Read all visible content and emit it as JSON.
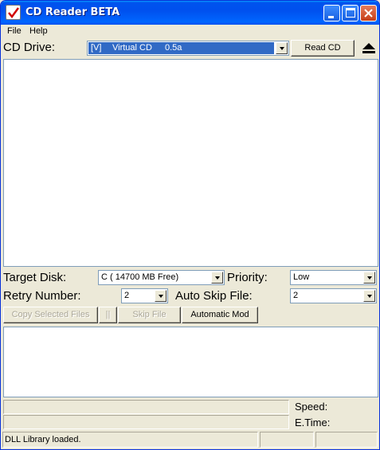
{
  "window": {
    "title": "CD Reader BETA"
  },
  "menu": {
    "file": "File",
    "help": "Help"
  },
  "drive": {
    "label": "CD Drive:",
    "selected_letter": "[V]",
    "selected_name": "Virtual CD",
    "selected_version": "0.5a",
    "read_button": "Read CD",
    "eject_icon": "eject-icon"
  },
  "settings": {
    "target_disk_label": "Target Disk:",
    "target_disk_value": "C ( 14700 MB Free)",
    "priority_label": "Priority:",
    "priority_value": "Low",
    "retry_label": "Retry Number:",
    "retry_value": "2",
    "auto_skip_label": "Auto Skip File:",
    "auto_skip_value": "2"
  },
  "actions": {
    "copy_selected": "Copy Selected Files",
    "pause": "||",
    "skip_file": "Skip File",
    "automatic_mod": "Automatic Mod"
  },
  "progress": {
    "speed_label": "Speed:",
    "etime_label": "E.Time:"
  },
  "statusbar": {
    "message": "DLL Library loaded."
  },
  "colors": {
    "titlebar": "#0053ee",
    "selection": "#316ac5",
    "window_bg": "#ece9d8"
  }
}
